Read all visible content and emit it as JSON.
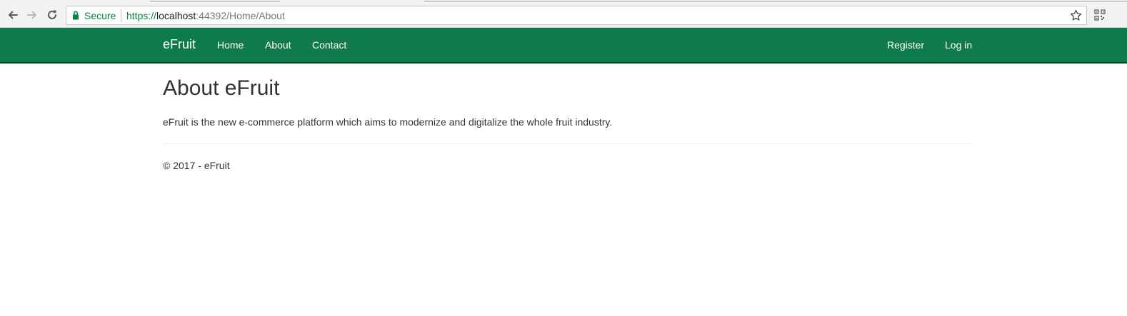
{
  "browser": {
    "secure_label": "Secure",
    "url": {
      "scheme": "https://",
      "host": "localhost",
      "rest": ":44392/Home/About"
    }
  },
  "navbar": {
    "brand": "eFruit",
    "links": [
      "Home",
      "About",
      "Contact"
    ],
    "right_links": [
      "Register",
      "Log in"
    ],
    "background_color": "#0f7a4c"
  },
  "main": {
    "title": "About eFruit",
    "text": "eFruit is the new e-commerce platform which aims to modernize and digitalize the whole fruit industry."
  },
  "footer": {
    "text": "© 2017 - eFruit"
  },
  "icons": {
    "back": "arrow-left-icon",
    "forward": "arrow-right-icon",
    "reload": "reload-icon",
    "lock": "lock-icon",
    "bookmark": "star-icon",
    "extension": "qr-code-icon"
  }
}
